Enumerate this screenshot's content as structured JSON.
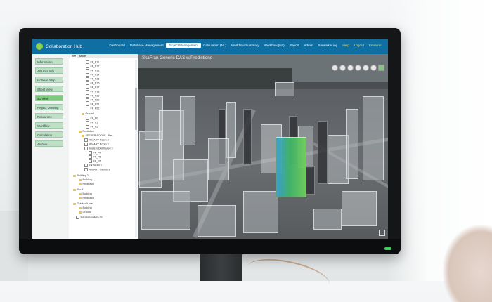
{
  "app": {
    "title": "Collaboration Hub"
  },
  "nav": {
    "items": [
      {
        "label": "Dashboard"
      },
      {
        "label": "Database Management"
      },
      {
        "label": "Project Management",
        "active": true
      },
      {
        "label": "Calculation (NL)"
      },
      {
        "label": "Workflow Summary"
      },
      {
        "label": "Workflow (NL)"
      },
      {
        "label": "Report"
      },
      {
        "label": "Admin"
      },
      {
        "label": "Sensaiker ing"
      },
      {
        "label": "Help"
      },
      {
        "label": "Logout"
      },
      {
        "label": "Emiliano"
      }
    ]
  },
  "sidebar": {
    "items": [
      {
        "label": "Information"
      },
      {
        "label": "All Units Info"
      },
      {
        "label": "Isolation Map"
      },
      {
        "label": "Sheet View"
      },
      {
        "label": "3D View",
        "active": true
      },
      {
        "label": "Project Drawing"
      },
      {
        "label": "Resources"
      },
      {
        "label": "Workflow"
      },
      {
        "label": "Calculation"
      },
      {
        "label": "Archive"
      }
    ]
  },
  "tree": {
    "tabs": [
      "Tree",
      "Model"
    ],
    "items": [
      "FF_F11",
      "FF_F12",
      "FF_F13",
      "FF_F14",
      "FF_F15",
      "FF_F16",
      "FF_F17",
      "FF_F18",
      "FF_F19",
      "FF_F20",
      "FF_F21",
      "FF_F22",
      "Ground",
      "FF_F0",
      "FF_F1",
      "FF_F2",
      "Prediction",
      "SEEPER FOCUS - Bar...",
      "RIMARY Room 2",
      "RIMARY Room 3",
      "System Distributed 3",
      "FF_F4",
      "FF_F5",
      "FF_F6",
      "Elk SEMI 3",
      "RIMARY Interior 3",
      "Building 2",
      "Building",
      "Prediction",
      "Pro 5",
      "Building",
      "Prediction",
      "Outdoor/Level",
      "Building",
      "Ground",
      "Installation Adm 3b..."
    ]
  },
  "viewer": {
    "title": "SkaFran Generic DAS w/Predictions",
    "tool_icons": [
      "home-icon",
      "rotate-icon",
      "settings-icon",
      "layers-icon",
      "info-icon",
      "measure-icon",
      "legend-icon"
    ]
  },
  "colors": {
    "topbar": "#0f6fa3",
    "sidebar_button": "#bfe0c7",
    "sidebar_active": "#7fc97f",
    "highlight_building": "#3fb56a"
  }
}
